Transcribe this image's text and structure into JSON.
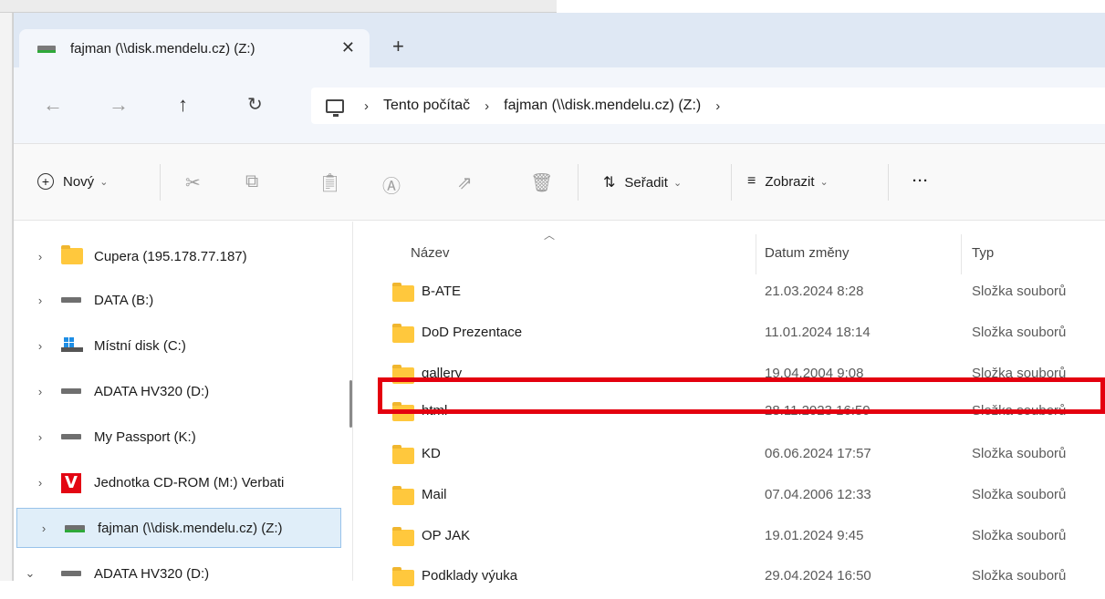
{
  "tab": {
    "title": "fajman (\\\\disk.mendelu.cz) (Z:)",
    "close": "✕",
    "new_tab": "+"
  },
  "nav": {
    "back": "←",
    "forward": "→",
    "up": "↑",
    "refresh": "↻"
  },
  "address": {
    "crumbs": [
      "Tento počítač",
      "fajman (\\\\disk.mendelu.cz) (Z:)"
    ],
    "sep": "›"
  },
  "toolbar": {
    "new_label": "Nový",
    "chevron": "⌄",
    "sort_label": "Seřadit",
    "view_label": "Zobrazit",
    "more": "···"
  },
  "tree": [
    {
      "label": "Cupera (195.178.77.187)",
      "icon": "folder-icon"
    },
    {
      "label": "DATA (B:)",
      "icon": "drive-icon"
    },
    {
      "label": "Místní disk (C:)",
      "icon": "windows-drive-icon"
    },
    {
      "label": "ADATA HV320 (D:)",
      "icon": "drive-icon"
    },
    {
      "label": "My Passport (K:)",
      "icon": "drive-icon"
    },
    {
      "label": "Jednotka CD-ROM (M:) Verbati",
      "icon": "verbatim-icon"
    },
    {
      "label": "fajman (\\\\disk.mendelu.cz) (Z:)",
      "icon": "network-drive-icon",
      "selected": true
    },
    {
      "label": "ADATA HV320 (D:)",
      "icon": "drive-icon",
      "expanded": true
    }
  ],
  "columns": {
    "name": "Název",
    "date": "Datum změny",
    "type": "Typ"
  },
  "files": [
    {
      "name": "B-ATE",
      "date": "21.03.2024 8:28",
      "type": "Složka souborů"
    },
    {
      "name": "DoD Prezentace",
      "date": "11.01.2024 18:14",
      "type": "Složka souborů"
    },
    {
      "name": "gallery",
      "date": "19.04.2004 9:08",
      "type": "Složka souborů"
    },
    {
      "name": "html",
      "date": "28.11.2023 16:59",
      "type": "Složka souborů"
    },
    {
      "name": "KD",
      "date": "06.06.2024 17:57",
      "type": "Složka souborů"
    },
    {
      "name": "Mail",
      "date": "07.04.2006 12:33",
      "type": "Složka souborů"
    },
    {
      "name": "OP JAK",
      "date": "19.01.2024 9:45",
      "type": "Složka souborů"
    },
    {
      "name": "Podklady výuka",
      "date": "29.04.2024 16:50",
      "type": "Složka souborů"
    }
  ],
  "colors": {
    "accent": "#e4000f",
    "folder": "#ffc83d",
    "selection": "#e0eef9"
  }
}
